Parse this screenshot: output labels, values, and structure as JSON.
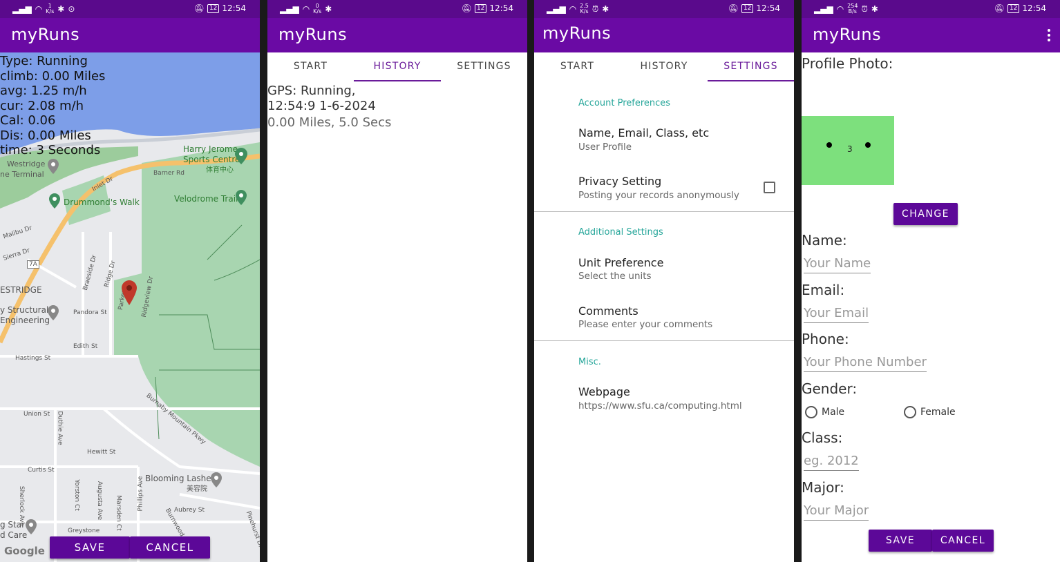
{
  "status_bar": {
    "time": "12:54",
    "battery": "12",
    "speeds": [
      [
        "1",
        "K/s"
      ],
      [
        "0",
        "K/s"
      ],
      [
        "2.5",
        "K/s"
      ],
      [
        "254",
        "B/s"
      ]
    ]
  },
  "app": {
    "title": "myRuns"
  },
  "colors": {
    "statusbar": "#5a0a8c",
    "appbar": "#6a0aa4",
    "accent": "#6a1b9a",
    "pref_category": "#26a69a",
    "button": "#5c0898"
  },
  "map_screen": {
    "stats": [
      "Type: Running",
      "climb: 0.00 Miles",
      "avg: 1.25 m/h",
      "cur: 2.08 m/h",
      "Cal: 0.06",
      "Dis: 0.00 Miles",
      "time: 3 Seconds"
    ],
    "map_labels": {
      "harry_jerome": "Harry Jerome",
      "sports_centre": "Sports Centre",
      "chinese_name": "体育中心",
      "westridge": "Westridge",
      "ne_terminal": "ne Terminal",
      "barner_rd": "Barner Rd",
      "inlet_dr": "Inlet Dr",
      "drummonds_walk": "Drummond's Walk",
      "velodrome_trail": "Velodrome Trail",
      "malibu_dr": "Malibu Dr",
      "sierra_dr": "Sierra Dr",
      "route_7a": "7A",
      "braeside_dr": "Braeside Dr",
      "ridge_dr": "Ridge Dr",
      "ridgeview_dr": "Ridgeview Dr",
      "parker": "Parker",
      "estridge": "ESTRIDGE",
      "structural": "y Structural",
      "engineering": "Engineering",
      "pandora_st": "Pandora St",
      "edith_st": "Edith St",
      "hastings_st": "Hastings St",
      "burnaby_mtn_pkwy": "Burnaby Mountain Pkwy",
      "union_st": "Union St",
      "duthie_ave": "Duthie Ave",
      "hewitt_st": "Hewitt St",
      "curtis_st": "Curtis St",
      "blooming_lashes": "Blooming Lashes",
      "blooming_cn": "美容院",
      "aubrey_st": "Aubrey St",
      "sherlock_ave": "Sherlock Ave",
      "yorston_ct": "Yorston Ct",
      "augusta_ave": "Augusta Ave",
      "marsden_ct": "Marsden Ct",
      "phillips_ave": "Phillips Ave",
      "burnwood": "Burnwood",
      "greystone": "Greystone",
      "pinehurst_dr": "Pinehurst Dr",
      "g_star": "g Star",
      "d_care": "d Care",
      "google": "Google"
    },
    "save_label": "SAVE",
    "cancel_label": "CANCEL"
  },
  "tabs": {
    "start": "START",
    "history": "HISTORY",
    "settings": "SETTINGS"
  },
  "history": {
    "entry_title_line1": "GPS: Running,",
    "entry_title_line2": "12:54:9 1-6-2024",
    "entry_summary": "0.00 Miles, 5.0 Secs"
  },
  "settings": {
    "cat_account": "Account Preferences",
    "profile_title": "Name, Email, Class, etc",
    "profile_summary": "User Profile",
    "privacy_title": "Privacy Setting",
    "privacy_summary": "Posting your records anonymously",
    "cat_additional": "Additional Settings",
    "unit_title": "Unit Preference",
    "unit_summary": "Select the units",
    "comments_title": "Comments",
    "comments_summary": "Please enter your comments",
    "cat_misc": "Misc.",
    "webpage_title": "Webpage",
    "webpage_summary": "https://www.sfu.ca/computing.html"
  },
  "profile": {
    "photo_label": "Profile Photo:",
    "change_label": "CHANGE",
    "name_label": "Name:",
    "name_placeholder": "Your Name",
    "email_label": "Email:",
    "email_placeholder": "Your Email",
    "phone_label": "Phone:",
    "phone_placeholder": "Your Phone Number",
    "gender_label": "Gender:",
    "male_label": "Male",
    "female_label": "Female",
    "class_label": "Class:",
    "class_placeholder": "eg. 2012",
    "major_label": "Major:",
    "major_placeholder": "Your Major",
    "save_label": "SAVE",
    "cancel_label": "CANCEL"
  }
}
